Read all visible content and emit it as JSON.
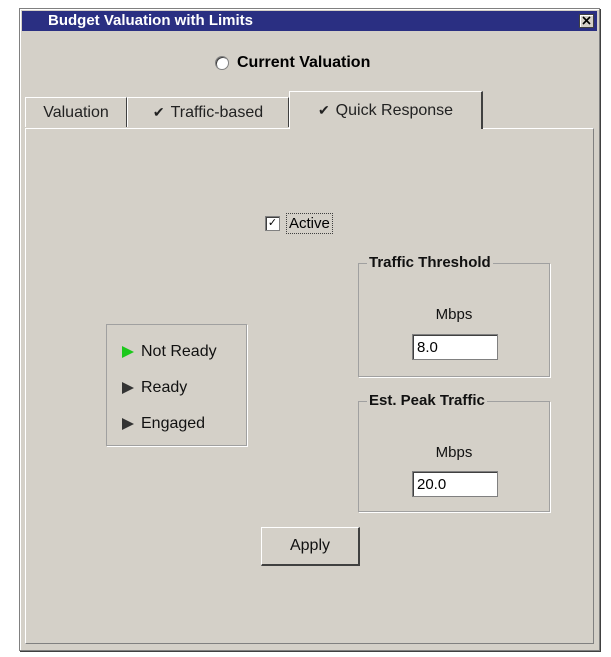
{
  "window": {
    "title": "Budget Valuation with Limits",
    "close_label": "×"
  },
  "valuation_mode": {
    "label": "Current Valuation",
    "selected": false
  },
  "tabs": [
    {
      "label": "Valuation",
      "checked": false,
      "active": false
    },
    {
      "label": "Traffic-based",
      "checked": true,
      "active": false
    },
    {
      "label": "Quick Response",
      "checked": true,
      "active": true
    }
  ],
  "check_glyph": "✔",
  "active_checkbox": {
    "label": "Active",
    "checked": true,
    "glyph": "✓"
  },
  "status": {
    "items": [
      {
        "label": "Not Ready",
        "color": "#1cc81c"
      },
      {
        "label": "Ready",
        "color": "#333333"
      },
      {
        "label": "Engaged",
        "color": "#333333"
      }
    ]
  },
  "traffic_threshold": {
    "title": "Traffic Threshold",
    "unit": "Mbps",
    "value": "8.0"
  },
  "est_peak_traffic": {
    "title": "Est. Peak Traffic",
    "unit": "Mbps",
    "value": "20.0"
  },
  "apply_label": "Apply"
}
